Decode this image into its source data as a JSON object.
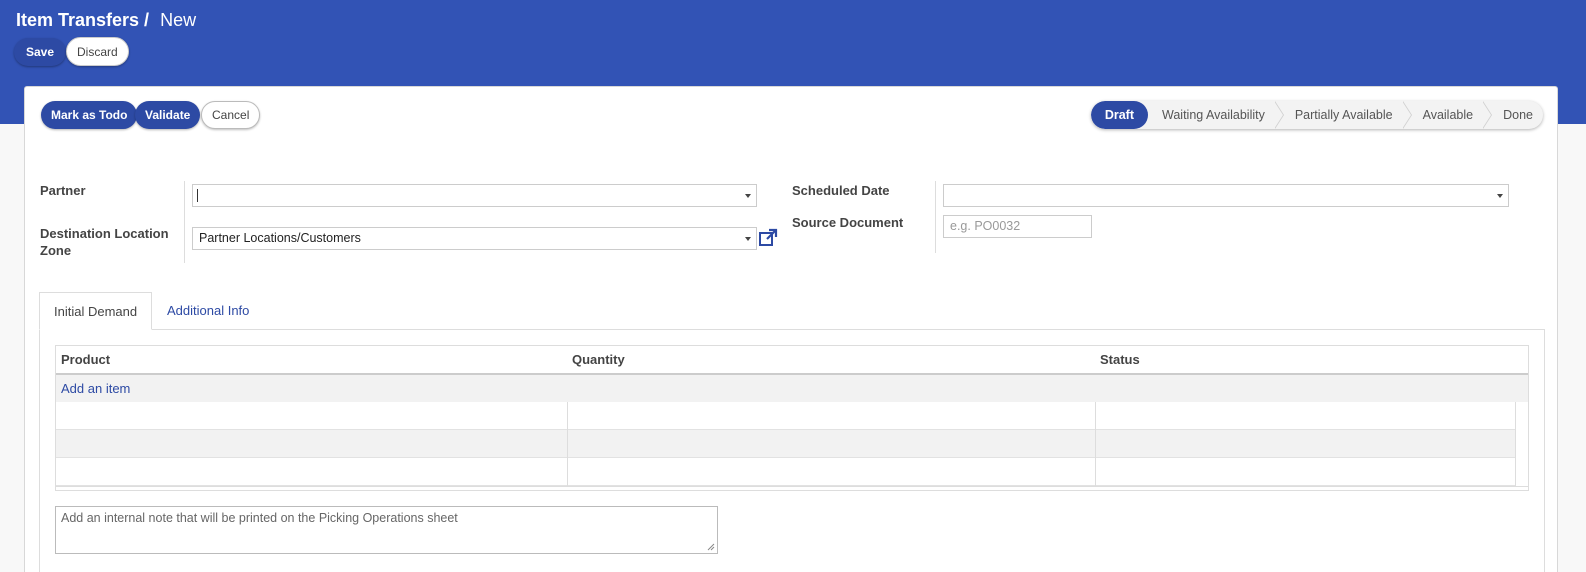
{
  "breadcrumb": {
    "parent": "Item Transfers /",
    "current": "New"
  },
  "toolbar": {
    "save_label": "Save",
    "discard_label": "Discard"
  },
  "actions": {
    "mark_todo": "Mark as Todo",
    "validate": "Validate",
    "cancel": "Cancel"
  },
  "statusbar": {
    "draft": "Draft",
    "waiting": "Waiting Availability",
    "partial": "Partially Available",
    "available": "Available",
    "done": "Done",
    "active": "Draft"
  },
  "form": {
    "partner_label": "Partner",
    "partner_value": "",
    "destination_label": "Destination Location Zone",
    "destination_value": "Partner Locations/Customers",
    "scheduled_label": "Scheduled Date",
    "scheduled_value": "",
    "source_label": "Source Document",
    "source_placeholder": "e.g. PO0032"
  },
  "tabs": {
    "initial": "Initial Demand",
    "additional": "Additional Info"
  },
  "table": {
    "columns": {
      "product": "Product",
      "quantity": "Quantity",
      "status": "Status"
    },
    "add_item": "Add an item"
  },
  "note": {
    "placeholder": "Add an internal note that will be printed on the Picking Operations sheet"
  },
  "colors": {
    "brand": "#3253b5",
    "primary_button": "#2d4aa4",
    "link": "#2d4aa4"
  },
  "icons": {
    "external_link": "external-link-icon",
    "dropdown": "caret-down-icon",
    "resize": "resize-grip-icon"
  }
}
